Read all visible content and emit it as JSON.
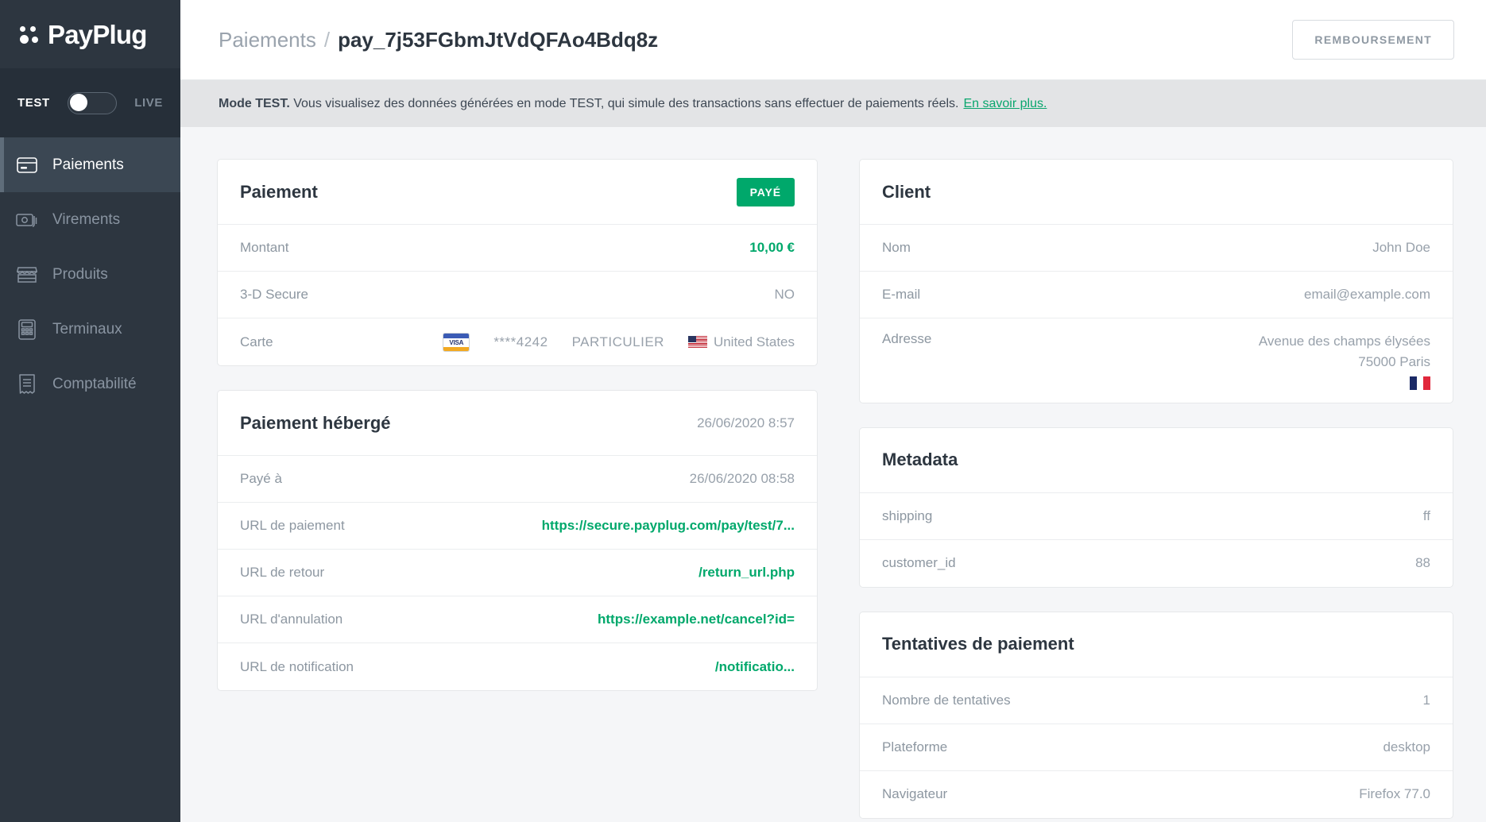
{
  "brand": {
    "name": "PayPlug"
  },
  "mode_switch": {
    "test_label": "TEST",
    "live_label": "LIVE",
    "active": "TEST"
  },
  "sidebar": {
    "items": [
      {
        "label": "Paiements",
        "icon": "credit-card-icon",
        "active": true
      },
      {
        "label": "Virements",
        "icon": "banknote-icon",
        "active": false
      },
      {
        "label": "Produits",
        "icon": "storefront-icon",
        "active": false
      },
      {
        "label": "Terminaux",
        "icon": "card-terminal-icon",
        "active": false
      },
      {
        "label": "Comptabilité",
        "icon": "invoice-icon",
        "active": false
      }
    ]
  },
  "header": {
    "breadcrumb_parent": "Paiements",
    "breadcrumb_separator": "/",
    "breadcrumb_current": "pay_7j53FGbmJtVdQFAo4Bdq8z",
    "refund_button": "REMBOURSEMENT"
  },
  "banner": {
    "strong": "Mode TEST.",
    "text": "Vous visualisez des données générées en mode TEST, qui simule des transactions sans effectuer de paiements réels.",
    "link": "En savoir plus."
  },
  "payment_card": {
    "title": "Paiement",
    "status_badge": "PAYÉ",
    "rows": [
      {
        "key": "Montant",
        "value": "10,00 €"
      },
      {
        "key": "3-D Secure",
        "value": "NO"
      }
    ],
    "card_row": {
      "key": "Carte",
      "brand_icon": "visa-icon",
      "brand_text": "VISA",
      "masked_number": "****4242",
      "holder_type": "PARTICULIER",
      "country_flag": "flag-us-icon",
      "country": "United States"
    }
  },
  "hosted_card": {
    "title": "Paiement hébergé",
    "timestamp": "26/06/2020 8:57",
    "rows": [
      {
        "key": "Payé à",
        "value": "26/06/2020 08:58",
        "link": false
      },
      {
        "key": "URL de paiement",
        "value": "https://secure.payplug.com/pay/test/7...",
        "link": true
      },
      {
        "key": "URL de retour",
        "value": "/return_url.php",
        "link": true
      },
      {
        "key": "URL d'annulation",
        "value": "https://example.net/cancel?id=",
        "link": true
      },
      {
        "key": "URL de notification",
        "value": "/notificatio...",
        "link": true
      }
    ]
  },
  "client_card": {
    "title": "Client",
    "rows": [
      {
        "key": "Nom",
        "value": "John Doe"
      },
      {
        "key": "E-mail",
        "value": "email@example.com"
      }
    ],
    "address_row": {
      "key": "Adresse",
      "line1": "Avenue des champs élysées",
      "line2": "75000 Paris",
      "country_flag": "flag-fr-icon"
    }
  },
  "metadata_card": {
    "title": "Metadata",
    "rows": [
      {
        "key": "shipping",
        "value": "ff"
      },
      {
        "key": "customer_id",
        "value": "88"
      }
    ]
  },
  "attempts_card": {
    "title": "Tentatives de paiement",
    "rows": [
      {
        "key": "Nombre de tentatives",
        "value": "1"
      },
      {
        "key": "Plateforme",
        "value": "desktop"
      },
      {
        "key": "Navigateur",
        "value": "Firefox 77.0"
      }
    ]
  },
  "colors": {
    "accent_green": "#00a86b",
    "sidebar_bg": "#2d3640",
    "sidebar_mode_bg": "#262f39",
    "page_bg": "#f5f6f8"
  }
}
